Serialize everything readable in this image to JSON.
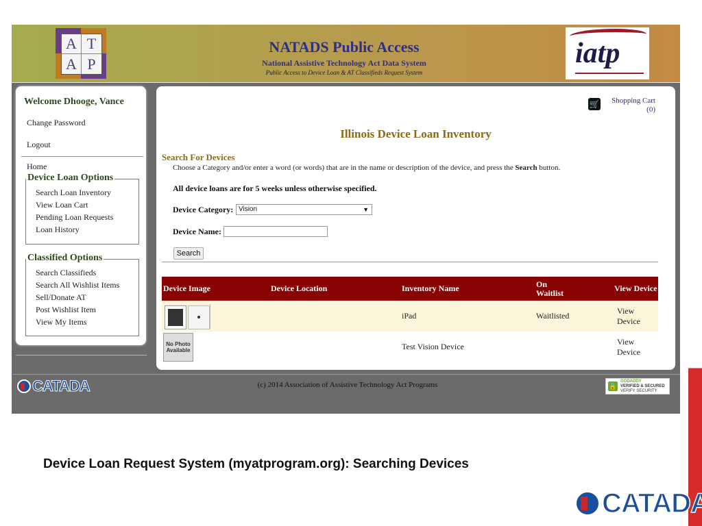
{
  "header": {
    "logo_letters": [
      "A",
      "T",
      "A",
      "P"
    ],
    "title": "NATADS Public Access",
    "subtitle": "National Assistive Technology Act Data System",
    "tagline": "Public Access to Device Loan & AT Classifieds Request System",
    "right_logo": "iatp"
  },
  "sidebar": {
    "welcome": "Welcome Dhooge, Vance",
    "change_password": "Change Password",
    "logout": "Logout",
    "home": "Home",
    "device_loan": {
      "legend": "Device Loan Options",
      "items": [
        "Search Loan Inventory",
        "View Loan Cart",
        "Pending Loan Requests",
        "Loan History"
      ]
    },
    "classified": {
      "legend": "Classified Options",
      "items": [
        "Search Classifieds",
        "Search All Wishlist Items",
        "Sell/Donate AT",
        "Post Wishlist Item",
        "View My Items"
      ]
    }
  },
  "main": {
    "cart_label": "Shopping Cart",
    "cart_count": "(0)",
    "inventory_title": "Illinois Device Loan Inventory",
    "search_heading": "Search For Devices",
    "search_desc_pre": "Choose a Category and/or enter a word (or words) that are in the name or description of the device, and press the ",
    "search_desc_bold": "Search",
    "search_desc_post": " button.",
    "loans_note": "All device loans are for 5 weeks unless otherwise specified.",
    "category_label": "Device Category:",
    "category_value": "Vision",
    "name_label": "Device Name:",
    "name_value": "",
    "search_button": "Search",
    "table": {
      "headers": [
        "Device Image",
        "Device Location",
        "Inventory Name",
        "On\nWaitlist",
        "View Device"
      ],
      "rows": [
        {
          "location": "",
          "name": "iPad",
          "waitlist": "Waitlisted",
          "view": "View Device"
        },
        {
          "location": "",
          "name": "Test Vision Device",
          "waitlist": "",
          "view": "View Device",
          "no_photo": "No Photo Available"
        }
      ]
    }
  },
  "footer": {
    "logo": "CATADA",
    "copyright": "(c) 2014 Association of Assistive Technology Act Programs",
    "badge_top": "GODADDY",
    "badge_mid": "VERIFIED & SECURED",
    "badge_bot": "VERIFY SECURITY"
  },
  "slide": {
    "caption": "Device Loan Request System (myatprogram.org): Searching Devices",
    "logo": "CATADA"
  },
  "colors": {
    "table_header": "#8a0303",
    "highlight_row": "#fbf6d9",
    "link_blue": "#2f2f84",
    "gold_title": "#8b6a18",
    "sidebar_green": "#2c4b1c",
    "slide_accent_red": "#d62b2b"
  }
}
